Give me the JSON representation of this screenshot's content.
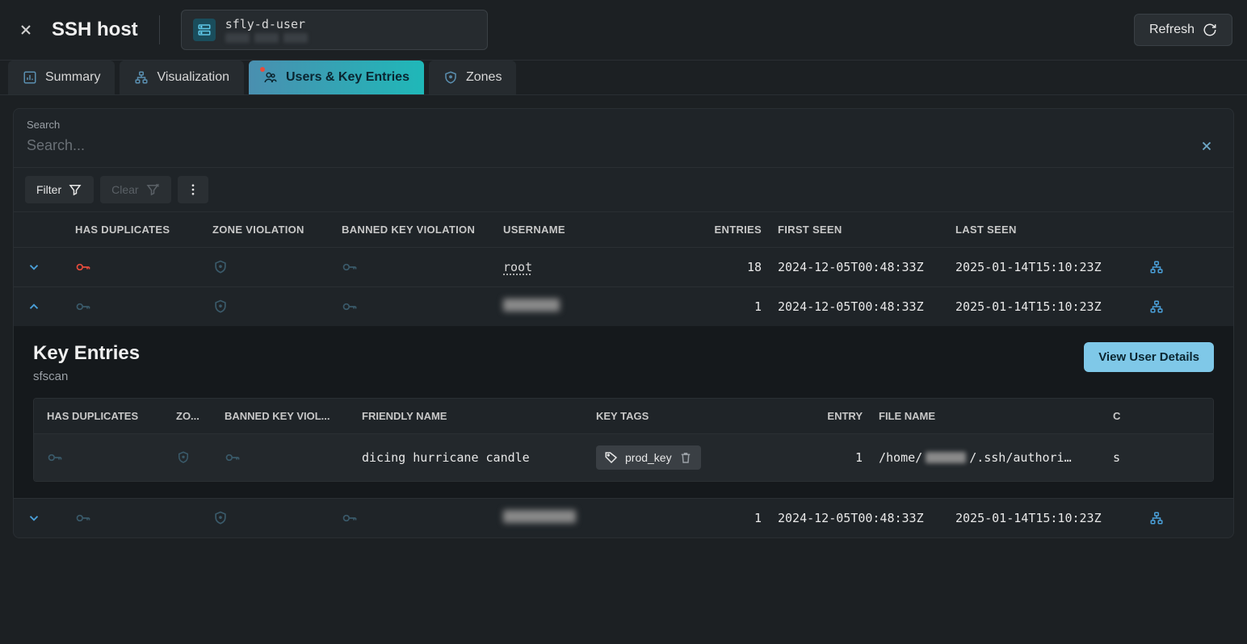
{
  "header": {
    "title": "SSH host",
    "host_name": "sfly-d-user",
    "refresh_label": "Refresh"
  },
  "tabs": [
    {
      "label": "Summary",
      "icon": "dashboard-icon"
    },
    {
      "label": "Visualization",
      "icon": "sitemap-icon"
    },
    {
      "label": "Users & Key Entries",
      "icon": "users-icon",
      "active": true,
      "alert": true
    },
    {
      "label": "Zones",
      "icon": "shield-icon"
    }
  ],
  "search": {
    "label": "Search",
    "placeholder": "Search..."
  },
  "toolbar": {
    "filter_label": "Filter",
    "clear_label": "Clear"
  },
  "columns": {
    "has_duplicates": "HAS DUPLICATES",
    "zone_violation": "ZONE VIOLATION",
    "banned_key_violation": "BANNED KEY VIOLATION",
    "username": "USERNAME",
    "entries": "ENTRIES",
    "first_seen": "FIRST SEEN",
    "last_seen": "LAST SEEN"
  },
  "rows": [
    {
      "expanded": false,
      "has_duplicates_icon": "red",
      "username": "root",
      "username_redacted": false,
      "entries": "18",
      "first_seen": "2024-12-05T00:48:33Z",
      "last_seen": "2025-01-14T15:10:23Z"
    },
    {
      "expanded": true,
      "has_duplicates_icon": "normal",
      "username": "",
      "username_redacted": true,
      "entries": "1",
      "first_seen": "2024-12-05T00:48:33Z",
      "last_seen": "2025-01-14T15:10:23Z"
    },
    {
      "expanded": false,
      "has_duplicates_icon": "normal",
      "username": "",
      "username_redacted": true,
      "entries": "1",
      "first_seen": "2024-12-05T00:48:33Z",
      "last_seen": "2025-01-14T15:10:23Z"
    }
  ],
  "sub": {
    "title": "Key Entries",
    "subtitle": "sfscan",
    "view_btn": "View User Details",
    "columns": {
      "has_duplicates": "HAS DUPLICATES",
      "zone": "ZO...",
      "banned": "BANNED KEY VIOL...",
      "friendly_name": "FRIENDLY NAME",
      "key_tags": "KEY TAGS",
      "entry": "ENTRY",
      "file_name": "FILE NAME",
      "c": "C"
    },
    "rows": [
      {
        "friendly_name": "dicing hurricane candle",
        "tag": "prod_key",
        "entry": "1",
        "file_prefix": "/home/",
        "file_suffix": "/.ssh/authori…",
        "c": "s"
      }
    ]
  }
}
